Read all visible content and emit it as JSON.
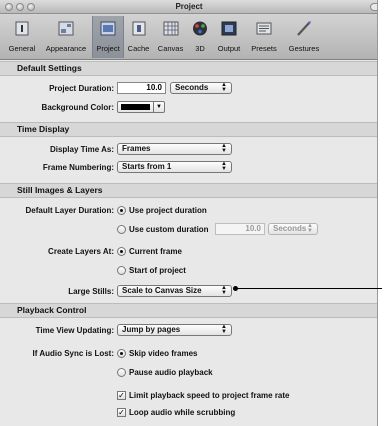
{
  "window": {
    "title": "Project"
  },
  "toolbar": {
    "items": [
      {
        "label": "General",
        "icon": "general-icon"
      },
      {
        "label": "Appearance",
        "icon": "appearance-icon"
      },
      {
        "label": "Project",
        "icon": "project-icon",
        "selected": true
      },
      {
        "label": "Cache",
        "icon": "cache-icon"
      },
      {
        "label": "Canvas",
        "icon": "canvas-icon"
      },
      {
        "label": "3D",
        "icon": "3d-icon"
      },
      {
        "label": "Output",
        "icon": "output-icon"
      },
      {
        "label": "Presets",
        "icon": "presets-icon"
      },
      {
        "label": "Gestures",
        "icon": "gestures-icon"
      }
    ]
  },
  "default_settings": {
    "header": "Default Settings",
    "project_duration_label": "Project Duration:",
    "project_duration_value": "10.0",
    "project_duration_unit": "Seconds",
    "background_color_label": "Background Color:",
    "background_color_value": "#000000"
  },
  "time_display": {
    "header": "Time Display",
    "display_time_as_label": "Display Time As:",
    "display_time_as_value": "Frames",
    "frame_numbering_label": "Frame Numbering:",
    "frame_numbering_value": "Starts from 1"
  },
  "still_images": {
    "header": "Still Images & Layers",
    "default_layer_duration_label": "Default Layer Duration:",
    "use_project_duration": "Use project duration",
    "use_custom_duration": "Use custom duration",
    "custom_duration_value": "10.0",
    "custom_duration_unit": "Seconds",
    "create_layers_at_label": "Create Layers At:",
    "current_frame": "Current frame",
    "start_of_project": "Start of project",
    "large_stills_label": "Large Stills:",
    "large_stills_value": "Scale to Canvas Size"
  },
  "playback_control": {
    "header": "Playback Control",
    "time_view_updating_label": "Time View Updating:",
    "time_view_updating_value": "Jump by pages",
    "audio_sync_label": "If Audio Sync is Lost:",
    "skip_video_frames": "Skip video frames",
    "pause_audio_playback": "Pause audio playback",
    "limit_playback_speed": "Limit playback speed to project frame rate",
    "loop_audio": "Loop audio while scrubbing"
  }
}
